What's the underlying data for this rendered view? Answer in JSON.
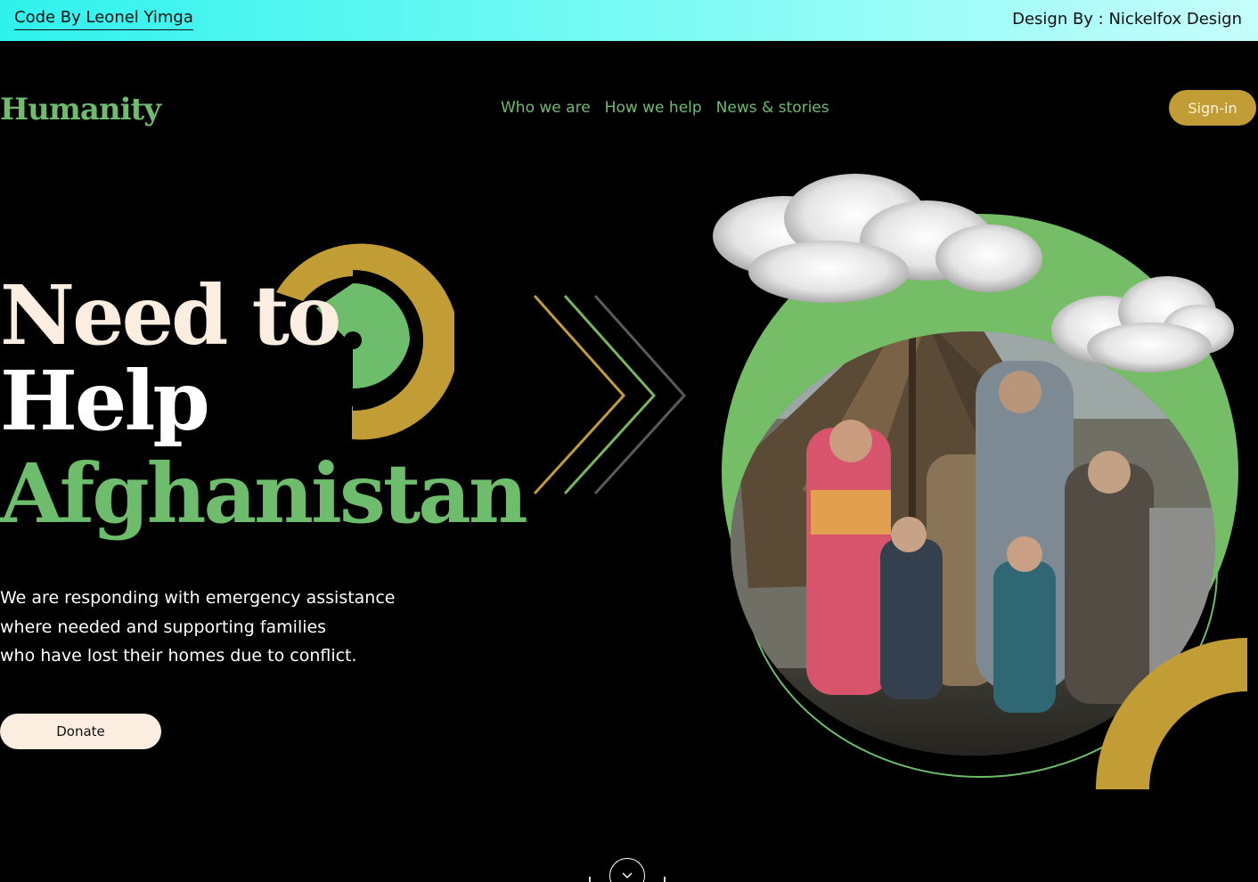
{
  "credits": {
    "code_by": "Code By Leonel Yimga",
    "design_by": "Design By : Nickelfox Design"
  },
  "header": {
    "logo": "Humanity",
    "nav": [
      "Who we are",
      "How we help",
      "News & stories"
    ],
    "signin_label": "Sign-in"
  },
  "hero": {
    "headline_line1": "Need to",
    "headline_line2": "Help",
    "headline_line3": "Afghanistan",
    "intro_lines": [
      "We are responding with emergency assistance",
      "where needed and supporting families",
      "who have lost their homes due to conflict."
    ],
    "donate_label": "Donate"
  },
  "colors": {
    "accent_green": "#6dbd6c",
    "accent_gold": "#c29d35",
    "cream": "#fbeee0",
    "background": "#000000"
  },
  "icons": {
    "scroll": "chevron-down-icon"
  }
}
